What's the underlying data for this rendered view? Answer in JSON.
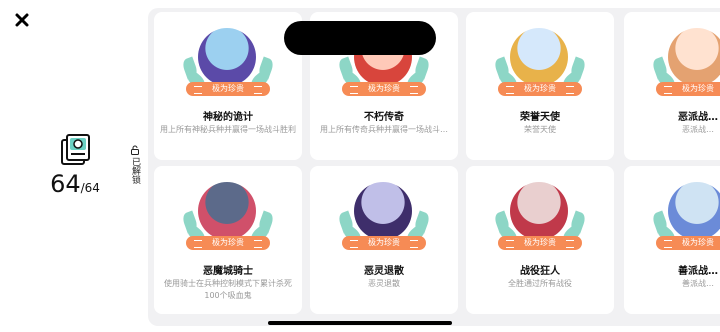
{
  "summary": {
    "collected": "64",
    "total": "/64",
    "unlocked_label": "已解锁"
  },
  "icons": {
    "close": "close-icon",
    "album": "badge-album-icon",
    "lock": "unlock-icon"
  },
  "colors": {
    "rarity_badge": "#f68b55",
    "leaves": "#8dd6c6"
  },
  "cards": [
    {
      "title": "神秘的诡计",
      "desc": "用上所有神秘兵种并赢得一场战斗胜利",
      "rarity": "极为珍贵",
      "art": [
        "#9cd0f0",
        "#5b4aa8"
      ]
    },
    {
      "title": "不朽传奇",
      "desc": "用上所有传奇兵种并赢得一场战斗…",
      "rarity": "极为珍贵",
      "art": [
        "#ffc9b8",
        "#d8453c"
      ]
    },
    {
      "title": "荣誉天使",
      "desc": "荣誉天使",
      "rarity": "极为珍贵",
      "art": [
        "#d5e8fb",
        "#e8b24a"
      ]
    },
    {
      "title": "恶派战…",
      "desc": "恶派战…",
      "rarity": "极为珍贵",
      "art": [
        "#ffe2d0",
        "#e4a271"
      ]
    },
    {
      "title": "恶魔城骑士",
      "desc": "使用骑士在兵种控制模式下累计杀死100个吸血鬼",
      "rarity": "极为珍贵",
      "art": [
        "#5c6a8a",
        "#d0506a"
      ]
    },
    {
      "title": "恶灵退散",
      "desc": "恶灵退散",
      "rarity": "极为珍贵",
      "art": [
        "#c0bfe8",
        "#3e2e6b"
      ]
    },
    {
      "title": "战役狂人",
      "desc": "全胜通过所有战役",
      "rarity": "极为珍贵",
      "art": [
        "#e9cfcf",
        "#c0394a"
      ]
    },
    {
      "title": "善派战…",
      "desc": "善派战…",
      "rarity": "极为珍贵",
      "art": [
        "#cfe3f3",
        "#6b8bd8"
      ]
    }
  ]
}
